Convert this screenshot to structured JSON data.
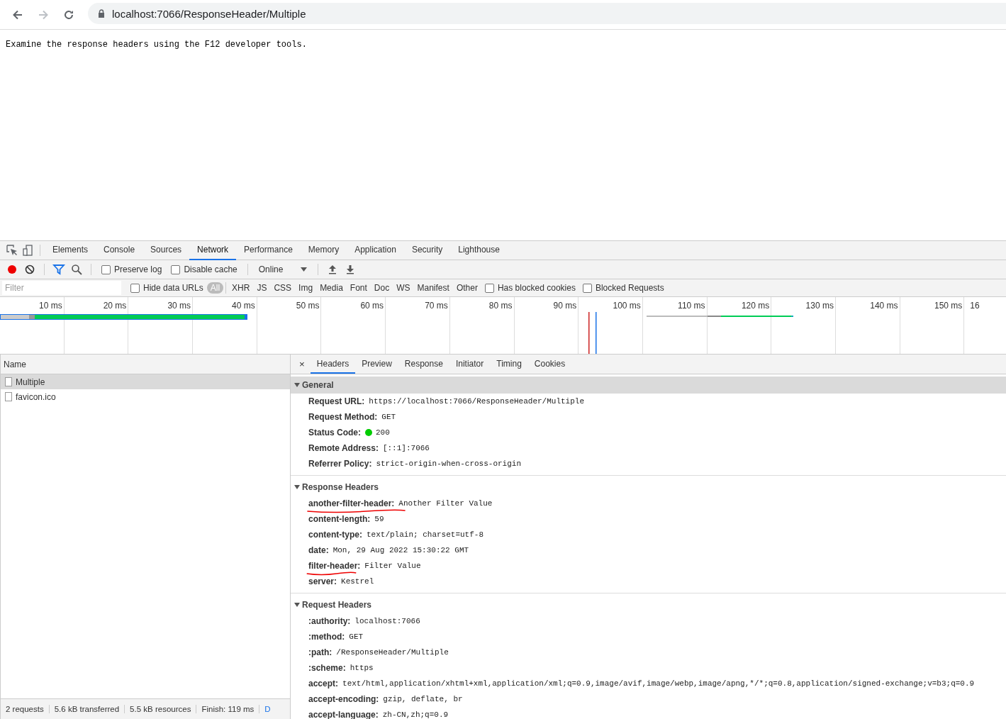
{
  "browser": {
    "url": "localhost:7066/ResponseHeader/Multiple"
  },
  "page": {
    "text": "Examine the response headers using the F12 developer tools."
  },
  "devtools": {
    "tabs": [
      {
        "label": "Elements",
        "selected": false
      },
      {
        "label": "Console",
        "selected": false
      },
      {
        "label": "Sources",
        "selected": false
      },
      {
        "label": "Network",
        "selected": true
      },
      {
        "label": "Performance",
        "selected": false
      },
      {
        "label": "Memory",
        "selected": false
      },
      {
        "label": "Application",
        "selected": false
      },
      {
        "label": "Security",
        "selected": false
      },
      {
        "label": "Lighthouse",
        "selected": false
      }
    ],
    "toolbar": {
      "recording": true,
      "preserve_log": {
        "label": "Preserve log",
        "checked": false
      },
      "disable_cache": {
        "label": "Disable cache",
        "checked": false
      },
      "throttling": "Online"
    },
    "filter_bar": {
      "placeholder": "Filter",
      "hide_data_urls": {
        "label": "Hide data URLs",
        "checked": false
      },
      "types": [
        {
          "label": "All",
          "selected": true
        },
        {
          "label": "XHR",
          "selected": false
        },
        {
          "label": "JS",
          "selected": false
        },
        {
          "label": "CSS",
          "selected": false
        },
        {
          "label": "Img",
          "selected": false
        },
        {
          "label": "Media",
          "selected": false
        },
        {
          "label": "Font",
          "selected": false
        },
        {
          "label": "Doc",
          "selected": false
        },
        {
          "label": "WS",
          "selected": false
        },
        {
          "label": "Manifest",
          "selected": false
        },
        {
          "label": "Other",
          "selected": false
        }
      ],
      "has_blocked_cookies": {
        "label": "Has blocked cookies",
        "checked": false
      },
      "blocked_requests": {
        "label": "Blocked Requests",
        "checked": false
      }
    },
    "overview": {
      "ticks": [
        "10 ms",
        "20 ms",
        "30 ms",
        "40 ms",
        "50 ms",
        "60 ms",
        "70 ms",
        "80 ms",
        "90 ms",
        "100 ms",
        "110 ms",
        "120 ms",
        "130 ms",
        "140 ms",
        "150 ms",
        "16"
      ]
    },
    "requests": {
      "column": "Name",
      "rows": [
        {
          "name": "Multiple",
          "selected": true
        },
        {
          "name": "favicon.ico",
          "selected": false
        }
      ]
    },
    "detail": {
      "close": "×",
      "tabs": [
        {
          "label": "Headers",
          "selected": true
        },
        {
          "label": "Preview",
          "selected": false
        },
        {
          "label": "Response",
          "selected": false
        },
        {
          "label": "Initiator",
          "selected": false
        },
        {
          "label": "Timing",
          "selected": false
        },
        {
          "label": "Cookies",
          "selected": false
        }
      ],
      "sections": [
        {
          "title": "General",
          "expanded": true,
          "selected": true,
          "rows": [
            {
              "name": "Request URL:",
              "value": "https://localhost:7066/ResponseHeader/Multiple",
              "kind": "text",
              "underlined": false
            },
            {
              "name": "Request Method:",
              "value": "GET",
              "kind": "text",
              "underlined": false
            },
            {
              "name": "Status Code:",
              "value": "200",
              "kind": "status",
              "underlined": false
            },
            {
              "name": "Remote Address:",
              "value": "[::1]:7066",
              "kind": "text",
              "underlined": false
            },
            {
              "name": "Referrer Policy:",
              "value": "strict-origin-when-cross-origin",
              "kind": "text",
              "underlined": false
            }
          ]
        },
        {
          "title": "Response Headers",
          "expanded": true,
          "selected": false,
          "rows": [
            {
              "name": "another-filter-header:",
              "value": "Another Filter Value",
              "kind": "text",
              "underlined": true
            },
            {
              "name": "content-length:",
              "value": "59",
              "kind": "text",
              "underlined": false
            },
            {
              "name": "content-type:",
              "value": "text/plain; charset=utf-8",
              "kind": "text",
              "underlined": false
            },
            {
              "name": "date:",
              "value": "Mon, 29 Aug 2022 15:30:22 GMT",
              "kind": "text",
              "underlined": false
            },
            {
              "name": "filter-header:",
              "value": "Filter Value",
              "kind": "text",
              "underlined": true
            },
            {
              "name": "server:",
              "value": "Kestrel",
              "kind": "text",
              "underlined": false
            }
          ]
        },
        {
          "title": "Request Headers",
          "expanded": true,
          "selected": false,
          "rows": [
            {
              "name": ":authority:",
              "value": "localhost:7066",
              "kind": "text",
              "underlined": false
            },
            {
              "name": ":method:",
              "value": "GET",
              "kind": "text",
              "underlined": false
            },
            {
              "name": ":path:",
              "value": "/ResponseHeader/Multiple",
              "kind": "text",
              "underlined": false
            },
            {
              "name": ":scheme:",
              "value": "https",
              "kind": "text",
              "underlined": false
            },
            {
              "name": "accept:",
              "value": "text/html,application/xhtml+xml,application/xml;q=0.9,image/avif,image/webp,image/apng,*/*;q=0.8,application/signed-exchange;v=b3;q=0.9",
              "kind": "text",
              "underlined": false
            },
            {
              "name": "accept-encoding:",
              "value": "gzip, deflate, br",
              "kind": "text",
              "underlined": false
            },
            {
              "name": "accept-language:",
              "value": "zh-CN,zh;q=0.9",
              "kind": "text",
              "underlined": false
            }
          ]
        }
      ]
    },
    "status_bar": [
      {
        "text": "2 requests",
        "kind": "text"
      },
      {
        "text": "5.6 kB transferred",
        "kind": "text"
      },
      {
        "text": "5.5 kB resources",
        "kind": "text"
      },
      {
        "text": "Finish: 119 ms",
        "kind": "text"
      },
      {
        "text": "D",
        "kind": "link"
      }
    ]
  }
}
